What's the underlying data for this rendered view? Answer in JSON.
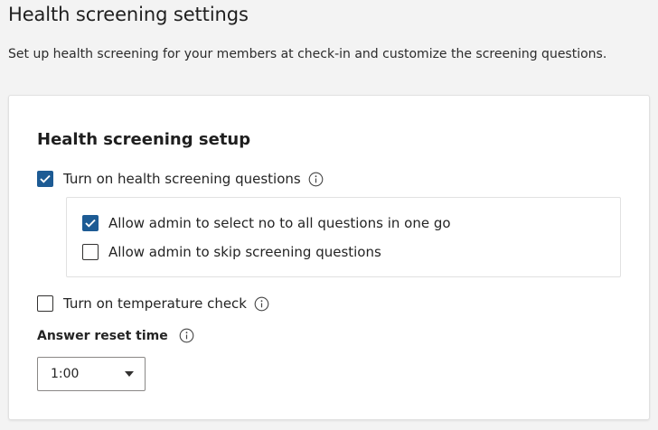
{
  "page": {
    "title": "Health screening settings",
    "subtitle": "Set up health screening for your members at check-in and customize the screening questions."
  },
  "setup": {
    "title": "Health screening setup",
    "screening_questions": {
      "label": "Turn on health screening questions",
      "checked": true,
      "info_icon": "info-icon"
    },
    "sub_options": [
      {
        "label": "Allow admin to select no to all questions in one go",
        "checked": true
      },
      {
        "label": "Allow admin to skip screening questions",
        "checked": false
      }
    ],
    "temperature_check": {
      "label": "Turn on temperature check",
      "checked": false,
      "info_icon": "info-icon"
    },
    "answer_reset": {
      "label": "Answer reset time",
      "value": "1:00",
      "icon": "chevron-down-icon"
    }
  },
  "colors": {
    "accent": "#1d5b94",
    "background": "#f3f3f3",
    "card": "#ffffff"
  }
}
